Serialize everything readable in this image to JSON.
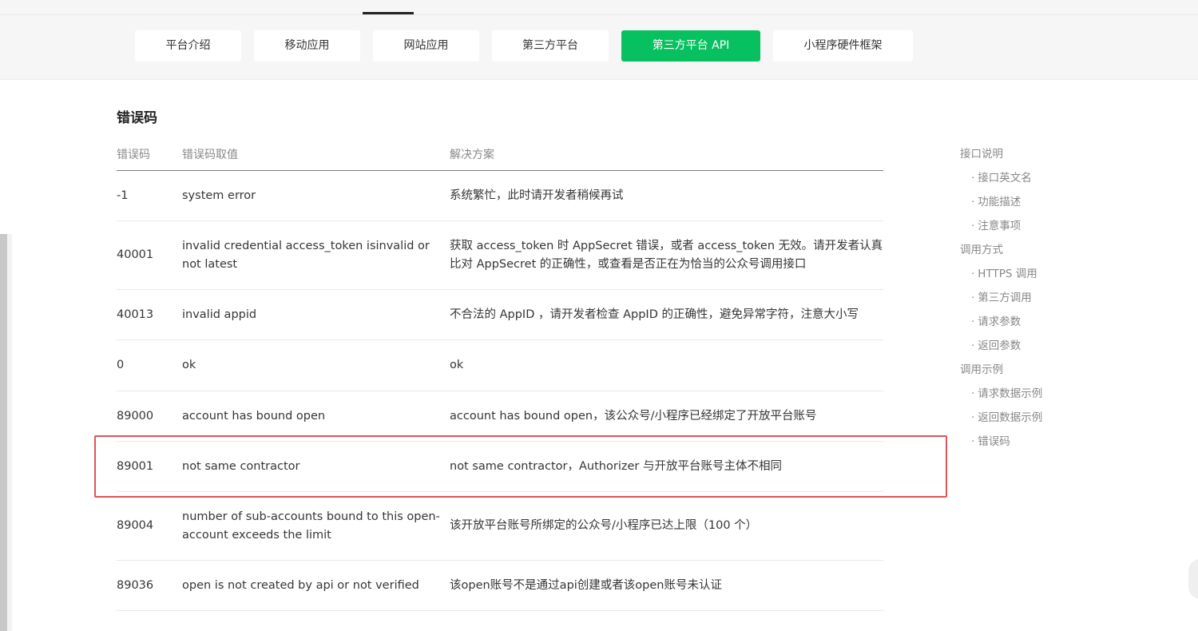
{
  "nav": {
    "tabs": [
      {
        "label": "平台介绍"
      },
      {
        "label": "移动应用"
      },
      {
        "label": "网站应用"
      },
      {
        "label": "第三方平台"
      },
      {
        "label": "第三方平台 API"
      },
      {
        "label": "小程序硬件框架"
      }
    ],
    "active_tab": "第三方平台 API",
    "accent_color": "#07c160"
  },
  "main": {
    "title": "错误码",
    "table": {
      "headers": [
        "错误码",
        "错误码取值",
        "解决方案"
      ],
      "rows": [
        {
          "code": "-1",
          "value": "system error",
          "solution": "系统繁忙，此时请开发者稍候再试"
        },
        {
          "code": "40001",
          "value": "invalid credential  access_token isinvalid or not latest",
          "solution": "获取 access_token 时 AppSecret 错误，或者 access_token 无效。请开发者认真比对 AppSecret 的正确性，或查看是否正在为恰当的公众号调用接口"
        },
        {
          "code": "40013",
          "value": "invalid appid",
          "solution": "不合法的 AppID ，请开发者检查 AppID 的正确性，避免异常字符，注意大小写"
        },
        {
          "code": "0",
          "value": "ok",
          "solution": "ok"
        },
        {
          "code": "89000",
          "value": "account has bound open",
          "solution": "account has bound open，该公众号/小程序已经绑定了开放平台账号"
        },
        {
          "code": "89001",
          "value": "not same contractor",
          "solution": "not same contractor，Authorizer 与开放平台账号主体不相同"
        },
        {
          "code": "89004",
          "value": "number of sub-accounts bound to this open-account exceeds the limit",
          "solution": "该开放平台账号所绑定的公众号/小程序已达上限（100 个）"
        },
        {
          "code": "89036",
          "value": "open is not created by api or not verified",
          "solution": "该open账号不是通过api创建或者该open账号未认证"
        }
      ]
    },
    "highlight_color": "#e05454"
  },
  "toc": {
    "sections": [
      {
        "label": "接口说明",
        "items": [
          "接口英文名",
          "功能描述",
          "注意事项"
        ]
      },
      {
        "label": "调用方式",
        "items": [
          "HTTPS 调用",
          "第三方调用",
          "请求参数",
          "返回参数"
        ]
      },
      {
        "label": "调用示例",
        "items": [
          "请求数据示例",
          "返回数据示例",
          "错误码"
        ]
      }
    ],
    "bullet": "·"
  }
}
